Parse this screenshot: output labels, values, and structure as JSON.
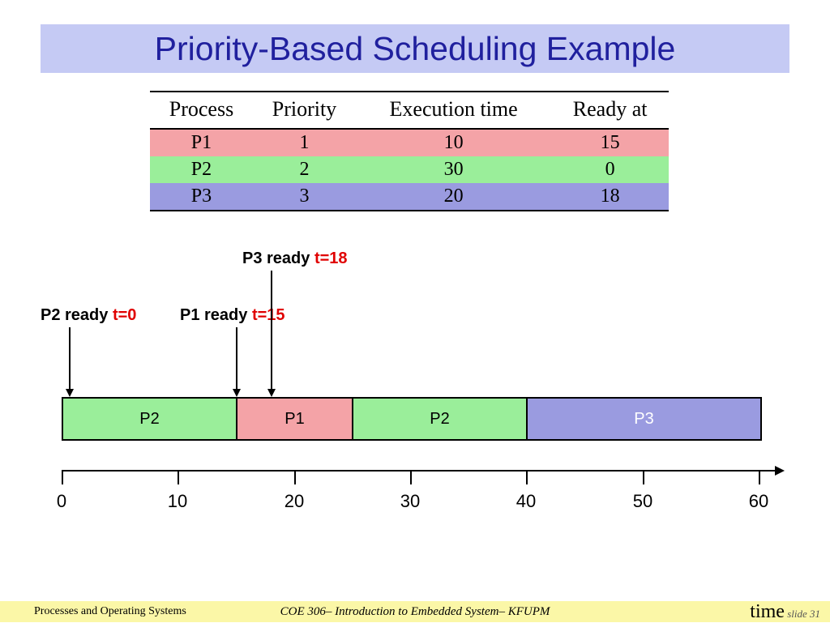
{
  "title": "Priority-Based Scheduling Example",
  "table": {
    "headers": {
      "process": "Process",
      "priority": "Priority",
      "exec": "Execution time",
      "ready": "Ready at"
    },
    "rows": [
      {
        "process": "P1",
        "priority": "1",
        "exec": "10",
        "ready": "15"
      },
      {
        "process": "P2",
        "priority": "2",
        "exec": "30",
        "ready": "0"
      },
      {
        "process": "P3",
        "priority": "3",
        "exec": "20",
        "ready": "18"
      }
    ]
  },
  "annotations": {
    "p3_ready_label": "P3 ready ",
    "p3_ready_time": "t=18",
    "p2_ready_label": "P2 ready ",
    "p2_ready_time": "t=0",
    "p1_ready_label": "P1 ready ",
    "p1_ready_time": "t=15"
  },
  "chart_data": {
    "type": "bar",
    "orientation": "gantt",
    "xlabel": "time",
    "xlim": [
      0,
      60
    ],
    "ticks": [
      0,
      10,
      20,
      30,
      40,
      50,
      60
    ],
    "pixels_per_unit": 14.333,
    "segments": [
      {
        "process": "P2",
        "start": 0,
        "end": 15,
        "label": "P2",
        "color": "green"
      },
      {
        "process": "P1",
        "start": 15,
        "end": 25,
        "label": "P1",
        "color": "pink"
      },
      {
        "process": "P2",
        "start": 25,
        "end": 40,
        "label": "P2",
        "color": "green"
      },
      {
        "process": "P3",
        "start": 40,
        "end": 60,
        "label": "P3",
        "color": "purple"
      }
    ],
    "ready_arrows": [
      {
        "process": "P2",
        "t": 0
      },
      {
        "process": "P1",
        "t": 15
      },
      {
        "process": "P3",
        "t": 18
      }
    ]
  },
  "axis_labels": {
    "t0": "0",
    "t10": "10",
    "t20": "20",
    "t30": "30",
    "t40": "40",
    "t50": "50",
    "t60": "60"
  },
  "footer": {
    "left": "Processes and Operating Systems",
    "center": "COE 306– Introduction to Embedded System– KFUPM",
    "time_label": "time",
    "slide": "slide 31"
  }
}
